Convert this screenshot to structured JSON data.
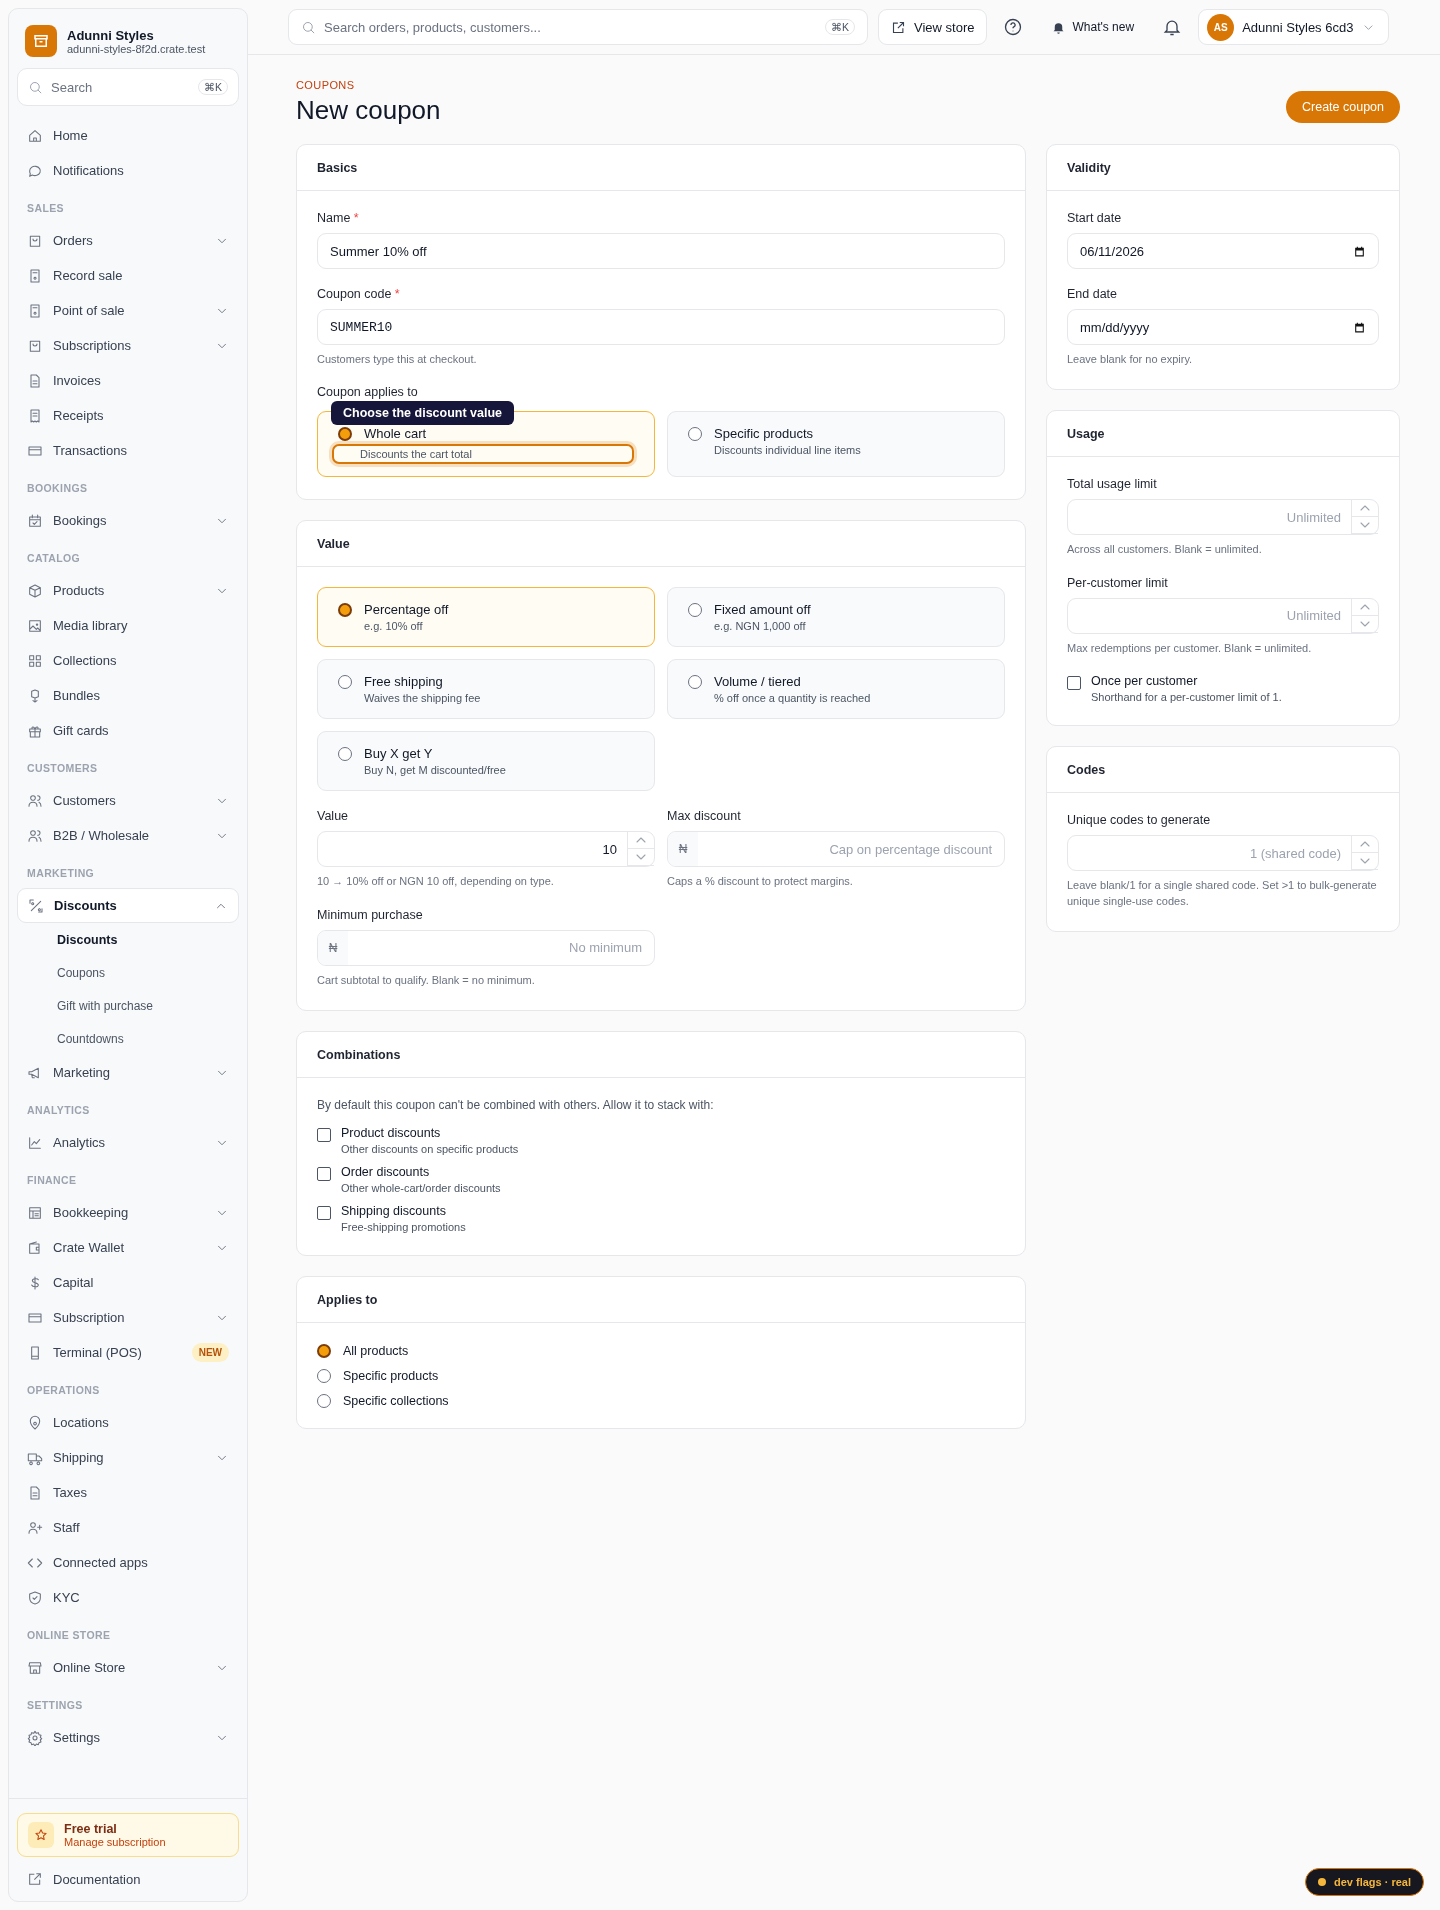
{
  "sidebar": {
    "brand": {
      "name": "Adunni Styles",
      "subdomain": "adunni-styles-8f2d.crate.test"
    },
    "search": {
      "placeholder": "Search",
      "shortcut": "⌘K"
    },
    "sections": [
      {
        "items": [
          {
            "label": "Home"
          },
          {
            "label": "Notifications"
          }
        ]
      },
      {
        "label": "SALES",
        "items": [
          {
            "label": "Orders",
            "expandable": true
          },
          {
            "label": "Record sale"
          },
          {
            "label": "Point of sale",
            "expandable": true
          },
          {
            "label": "Subscriptions",
            "expandable": true
          },
          {
            "label": "Invoices"
          },
          {
            "label": "Receipts"
          },
          {
            "label": "Transactions"
          }
        ]
      },
      {
        "label": "BOOKINGS",
        "items": [
          {
            "label": "Bookings",
            "expandable": true
          }
        ]
      },
      {
        "label": "CATALOG",
        "items": [
          {
            "label": "Products",
            "expandable": true
          },
          {
            "label": "Media library"
          },
          {
            "label": "Collections"
          },
          {
            "label": "Bundles"
          },
          {
            "label": "Gift cards"
          }
        ]
      },
      {
        "label": "CUSTOMERS",
        "items": [
          {
            "label": "Customers",
            "expandable": true
          },
          {
            "label": "B2B / Wholesale",
            "expandable": true
          }
        ]
      },
      {
        "label": "MARKETING",
        "items": [
          {
            "label": "Discounts",
            "expandable": true,
            "expanded": true,
            "children": [
              {
                "label": "Discounts",
                "selected": true
              },
              {
                "label": "Coupons",
                "selected": false
              },
              {
                "label": "Gift with purchase",
                "selected": false
              },
              {
                "label": "Countdowns",
                "selected": false
              }
            ]
          },
          {
            "label": "Marketing",
            "expandable": true
          }
        ]
      },
      {
        "label": "ANALYTICS",
        "items": [
          {
            "label": "Analytics",
            "expandable": true
          }
        ]
      },
      {
        "label": "FINANCE",
        "items": [
          {
            "label": "Bookkeeping",
            "expandable": true
          },
          {
            "label": "Crate Wallet",
            "expandable": true
          },
          {
            "label": "Capital"
          },
          {
            "label": "Subscription",
            "expandable": true
          },
          {
            "label": "Terminal (POS)",
            "badge": "NEW"
          }
        ]
      },
      {
        "label": "OPERATIONS",
        "items": [
          {
            "label": "Locations"
          },
          {
            "label": "Shipping",
            "expandable": true
          },
          {
            "label": "Taxes"
          },
          {
            "label": "Staff"
          },
          {
            "label": "Connected apps"
          },
          {
            "label": "KYC"
          }
        ]
      },
      {
        "label": "ONLINE STORE",
        "items": [
          {
            "label": "Online Store",
            "expandable": true
          }
        ]
      },
      {
        "label": "SETTINGS",
        "items": [
          {
            "label": "Settings",
            "expandable": true
          }
        ]
      }
    ],
    "trial": {
      "title": "Free trial",
      "subtitle": "Manage subscription"
    },
    "documentation": "Documentation"
  },
  "topbar": {
    "search": {
      "placeholder": "Search orders, products, customers...",
      "shortcut": "⌘K"
    },
    "view_store": "View store",
    "whats_new": "What's new",
    "account": {
      "initials": "AS",
      "name": "Adunni Styles 6cd3"
    }
  },
  "page": {
    "eyebrow": "COUPONS",
    "title": "New coupon",
    "action": "Create coupon"
  },
  "basics": {
    "title": "Basics",
    "name": {
      "label": "Name",
      "required_mark": "*",
      "value": "Summer 10% off"
    },
    "code": {
      "label": "Coupon code",
      "required_mark": "*",
      "value": "SUMMER10",
      "hint": "Customers type this at checkout."
    },
    "applies_label": "Coupon applies to",
    "options": [
      {
        "title": "Whole cart",
        "description": "Discounts the cart total",
        "selected": true,
        "highlighted": true
      },
      {
        "title": "Specific products",
        "description": "Discounts individual line items",
        "selected": false,
        "highlighted": false
      }
    ],
    "tooltip": "Choose the discount value"
  },
  "value": {
    "title": "Value",
    "types": [
      {
        "title": "Percentage off",
        "description": "e.g. 10% off",
        "selected": true
      },
      {
        "title": "Fixed amount off",
        "description": "e.g. NGN 1,000 off",
        "selected": false
      },
      {
        "title": "Free shipping",
        "description": "Waives the shipping fee",
        "selected": false
      },
      {
        "title": "Volume / tiered",
        "description": "% off once a quantity is reached",
        "selected": false
      },
      {
        "title": "Buy X get Y",
        "description": "Buy N, get M discounted/free",
        "selected": false
      }
    ],
    "amount": {
      "label": "Value",
      "value": "10",
      "hint": "10 → 10% off or NGN 10 off, depending on type."
    },
    "max_discount": {
      "label": "Max discount",
      "prefix": "₦",
      "placeholder": "Cap on percentage discount",
      "hint": "Caps a % discount to protect margins."
    },
    "minimum": {
      "label": "Minimum purchase",
      "prefix": "₦",
      "placeholder": "No minimum",
      "hint": "Cart subtotal to qualify. Blank = no minimum."
    }
  },
  "combinations": {
    "title": "Combinations",
    "intro": "By default this coupon can't be combined with others. Allow it to stack with:",
    "options": [
      {
        "label": "Product discounts",
        "description": "Other discounts on specific products",
        "checked": false
      },
      {
        "label": "Order discounts",
        "description": "Other whole-cart/order discounts",
        "checked": false
      },
      {
        "label": "Shipping discounts",
        "description": "Free-shipping promotions",
        "checked": false
      }
    ]
  },
  "applies_to": {
    "title": "Applies to",
    "options": [
      {
        "label": "All products",
        "selected": true
      },
      {
        "label": "Specific products",
        "selected": false
      },
      {
        "label": "Specific collections",
        "selected": false
      }
    ]
  },
  "validity": {
    "title": "Validity",
    "start": {
      "label": "Start date",
      "value": "06/11/2026"
    },
    "end": {
      "label": "End date",
      "placeholder": "mm/dd/yyyy",
      "hint": "Leave blank for no expiry."
    }
  },
  "usage": {
    "title": "Usage",
    "total": {
      "label": "Total usage limit",
      "placeholder": "Unlimited",
      "hint": "Across all customers. Blank = unlimited."
    },
    "per_customer": {
      "label": "Per-customer limit",
      "placeholder": "Unlimited",
      "hint": "Max redemptions per customer. Blank = unlimited."
    },
    "once": {
      "label": "Once per customer",
      "description": "Shorthand for a per-customer limit of 1.",
      "checked": false
    }
  },
  "codes": {
    "title": "Codes",
    "field": {
      "label": "Unique codes to generate",
      "placeholder": "1 (shared code)",
      "hint": "Leave blank/1 for a single shared code. Set >1 to bulk-generate unique single-use codes."
    }
  },
  "dev_badge": "dev flags · real"
}
